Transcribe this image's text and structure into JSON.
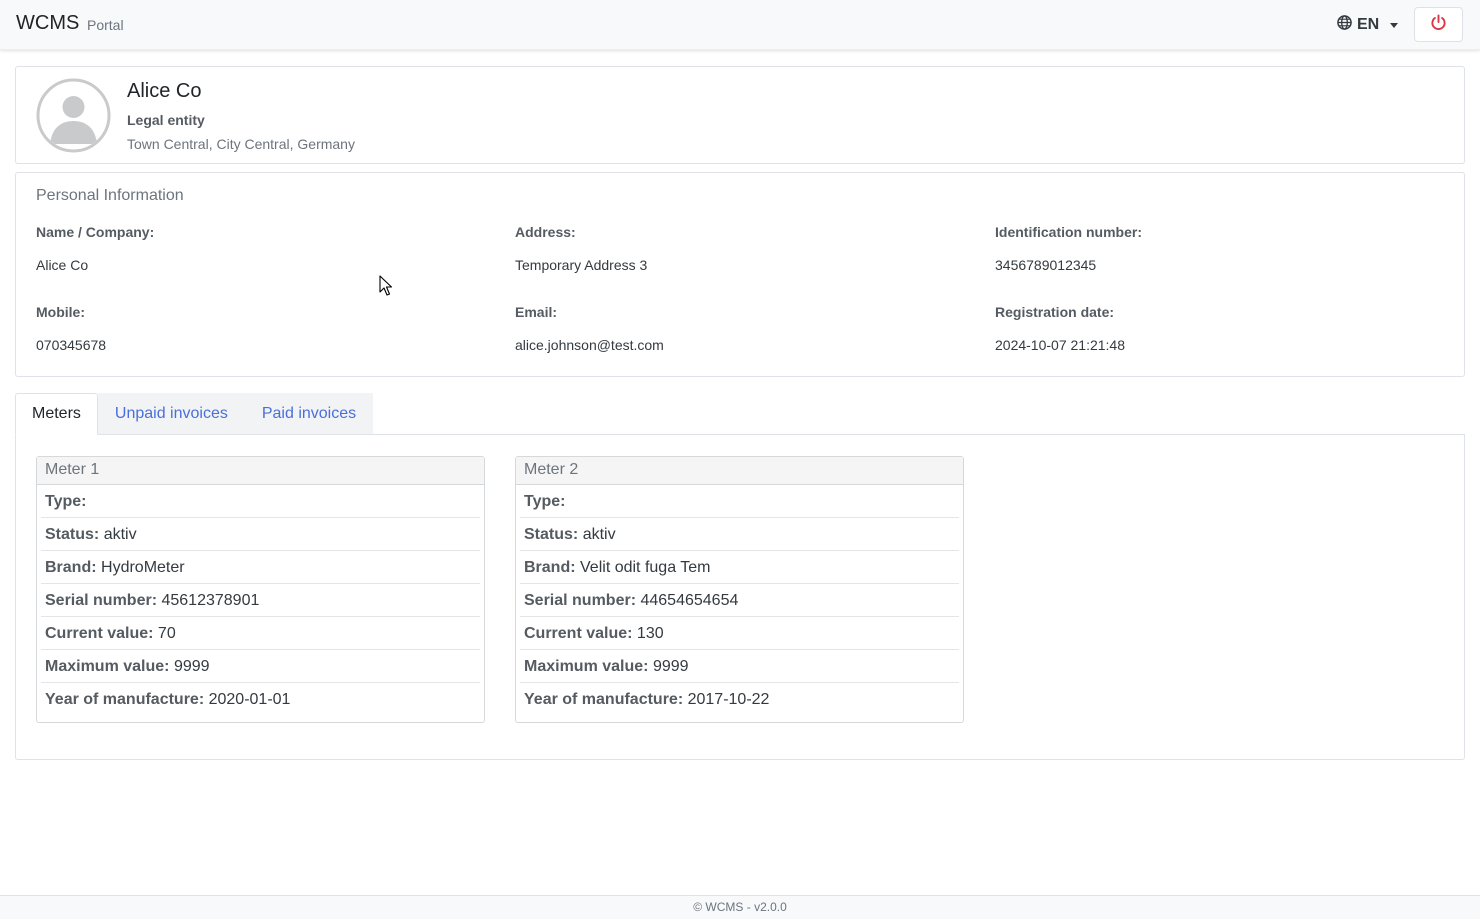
{
  "header": {
    "brand": "WCMS",
    "brand_sub": "Portal",
    "language": "EN",
    "logout_icon": "power-icon",
    "logout_color": "#dc3545"
  },
  "profile": {
    "name": "Alice Co",
    "type": "Legal entity",
    "location": "Town Central, City Central, Germany"
  },
  "personal_info": {
    "title": "Personal Information",
    "fields": {
      "name_label": "Name / Company:",
      "name_value": "Alice Co",
      "address_label": "Address:",
      "address_value": "Temporary Address 3",
      "id_label": "Identification number:",
      "id_value": "3456789012345",
      "mobile_label": "Mobile:",
      "mobile_value": "070345678",
      "email_label": "Email:",
      "email_value": "alice.johnson@test.com",
      "reg_label": "Registration date:",
      "reg_value": "2024-10-07 21:21:48"
    }
  },
  "tabs": [
    {
      "label": "Meters",
      "active": true
    },
    {
      "label": "Unpaid invoices",
      "active": false
    },
    {
      "label": "Paid invoices",
      "active": false
    }
  ],
  "meter_labels": {
    "type": "Type:",
    "status": "Status:",
    "brand": "Brand:",
    "serial": "Serial number:",
    "current": "Current value:",
    "maximum": "Maximum value:",
    "year": "Year of manufacture:"
  },
  "meters": [
    {
      "title": "Meter 1",
      "type": "",
      "status": "aktiv",
      "brand": "HydroMeter",
      "serial": "45612378901",
      "current": "70",
      "maximum": "9999",
      "year": "2020-01-01"
    },
    {
      "title": "Meter 2",
      "type": "",
      "status": "aktiv",
      "brand": "Velit odit fuga Tem",
      "serial": "44654654654",
      "current": "130",
      "maximum": "9999",
      "year": "2017-10-22"
    }
  ],
  "footer": {
    "text": "© WCMS - v2.0.0"
  },
  "colors": {
    "accent_link": "#4a6fdc",
    "navbar_bg": "#f8f9fa"
  }
}
